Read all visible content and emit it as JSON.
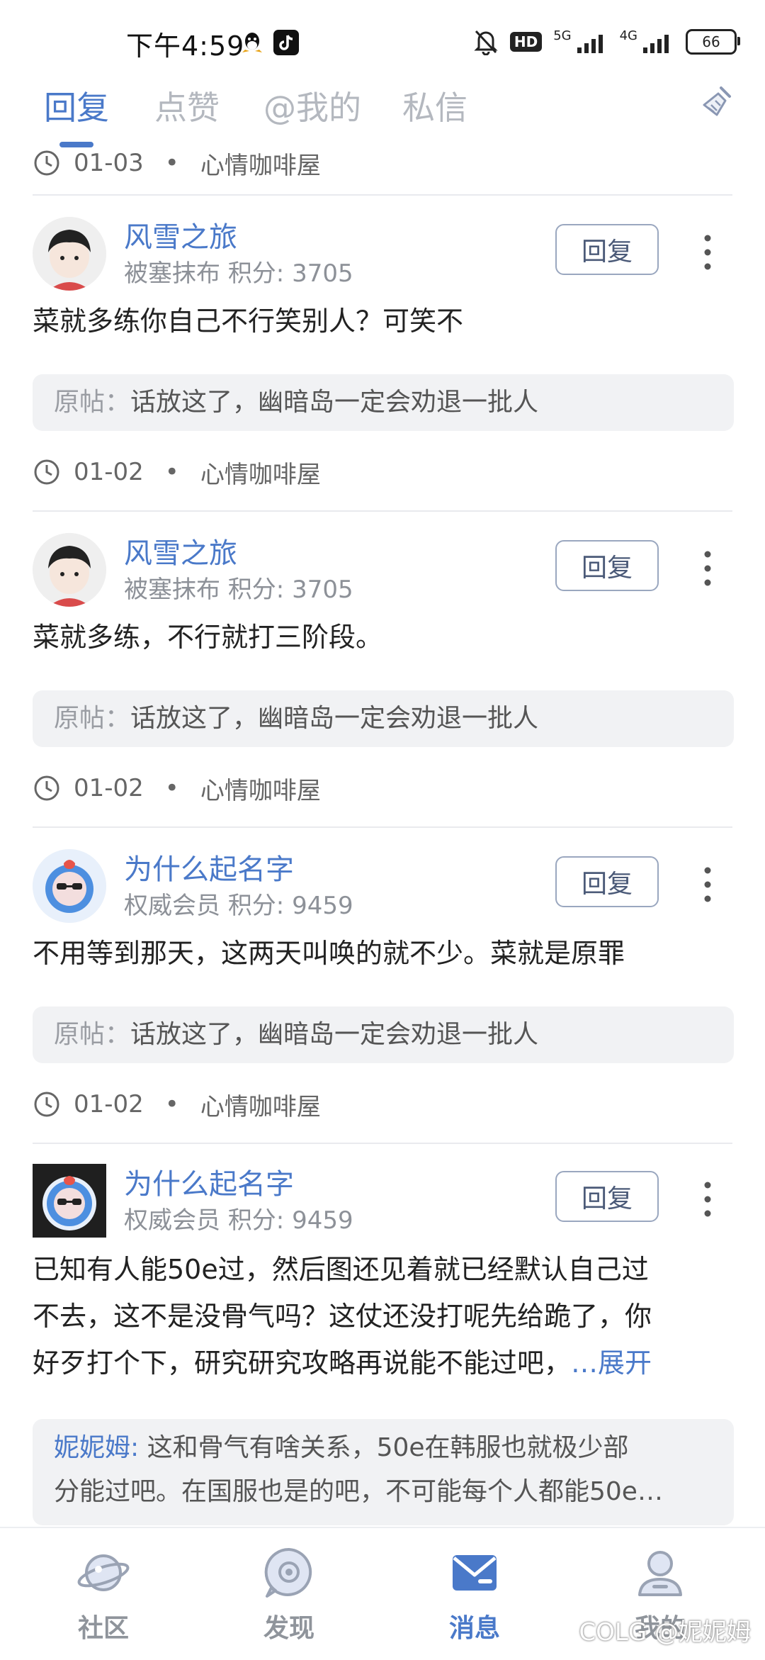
{
  "status_bar": {
    "time": "下午4:59",
    "hd": "HD",
    "net1": "5G",
    "net2": "4G",
    "battery": "66"
  },
  "tabs": [
    {
      "label": "回复",
      "active": true
    },
    {
      "label": "点赞"
    },
    {
      "label": "@我的"
    },
    {
      "label": "私信"
    }
  ],
  "top_partial": {
    "date": "01-03",
    "dot": "•",
    "forum": "心情咖啡屋"
  },
  "items": [
    {
      "username": "风雪之旅",
      "rank": "被塞抹布",
      "points": "积分: 3705",
      "comment": "菜就多练你自己不行笑别人？可笑不",
      "quote_label": "原帖：",
      "quote_text": "话放这了，幽暗岛一定会劝退一批人",
      "date": "01-02",
      "dot": "•",
      "forum": "心情咖啡屋",
      "reply_label": "回复"
    },
    {
      "username": "风雪之旅",
      "rank": "被塞抹布",
      "points": "积分: 3705",
      "comment": "菜就多练，不行就打三阶段。",
      "quote_label": "原帖：",
      "quote_text": "话放这了，幽暗岛一定会劝退一批人",
      "date": "01-02",
      "dot": "•",
      "forum": "心情咖啡屋",
      "reply_label": "回复"
    },
    {
      "username": "为什么起名字",
      "rank": "权威会员",
      "points": "积分: 9459",
      "comment": "不用等到那天，这两天叫唤的就不少。菜就是原罪",
      "quote_label": "原帖：",
      "quote_text": "话放这了，幽暗岛一定会劝退一批人",
      "date": "01-02",
      "dot": "•",
      "forum": "心情咖啡屋",
      "reply_label": "回复"
    },
    {
      "username": "为什么起名字",
      "rank": "权威会员",
      "points": "积分: 9459",
      "comment_lines": [
        "已知有人能50e过，然后图还见着就已经默认自己过",
        "不去，这不是没骨气吗？这仗还没打呢先给跪了，你",
        "好歹打个下，研究研究攻略再说能不能过吧，"
      ],
      "expand": "…展开",
      "quote_user": "妮妮姆:",
      "quote_lines": [
        "这和骨气有啥关系，50e在韩服也就极少部",
        "分能过吧。在国服也是的吧，不可能每个人都能50e…"
      ],
      "reply_label": "回复"
    }
  ],
  "bottom_nav": [
    {
      "label": "社区",
      "icon": "planet-icon"
    },
    {
      "label": "发现",
      "icon": "discover-icon"
    },
    {
      "label": "消息",
      "icon": "message-icon",
      "active": true
    },
    {
      "label": "我的",
      "icon": "profile-icon"
    }
  ],
  "watermark": "COLG @妮妮姆",
  "colors": {
    "accent": "#4a79c9",
    "muted": "#8d9198"
  }
}
